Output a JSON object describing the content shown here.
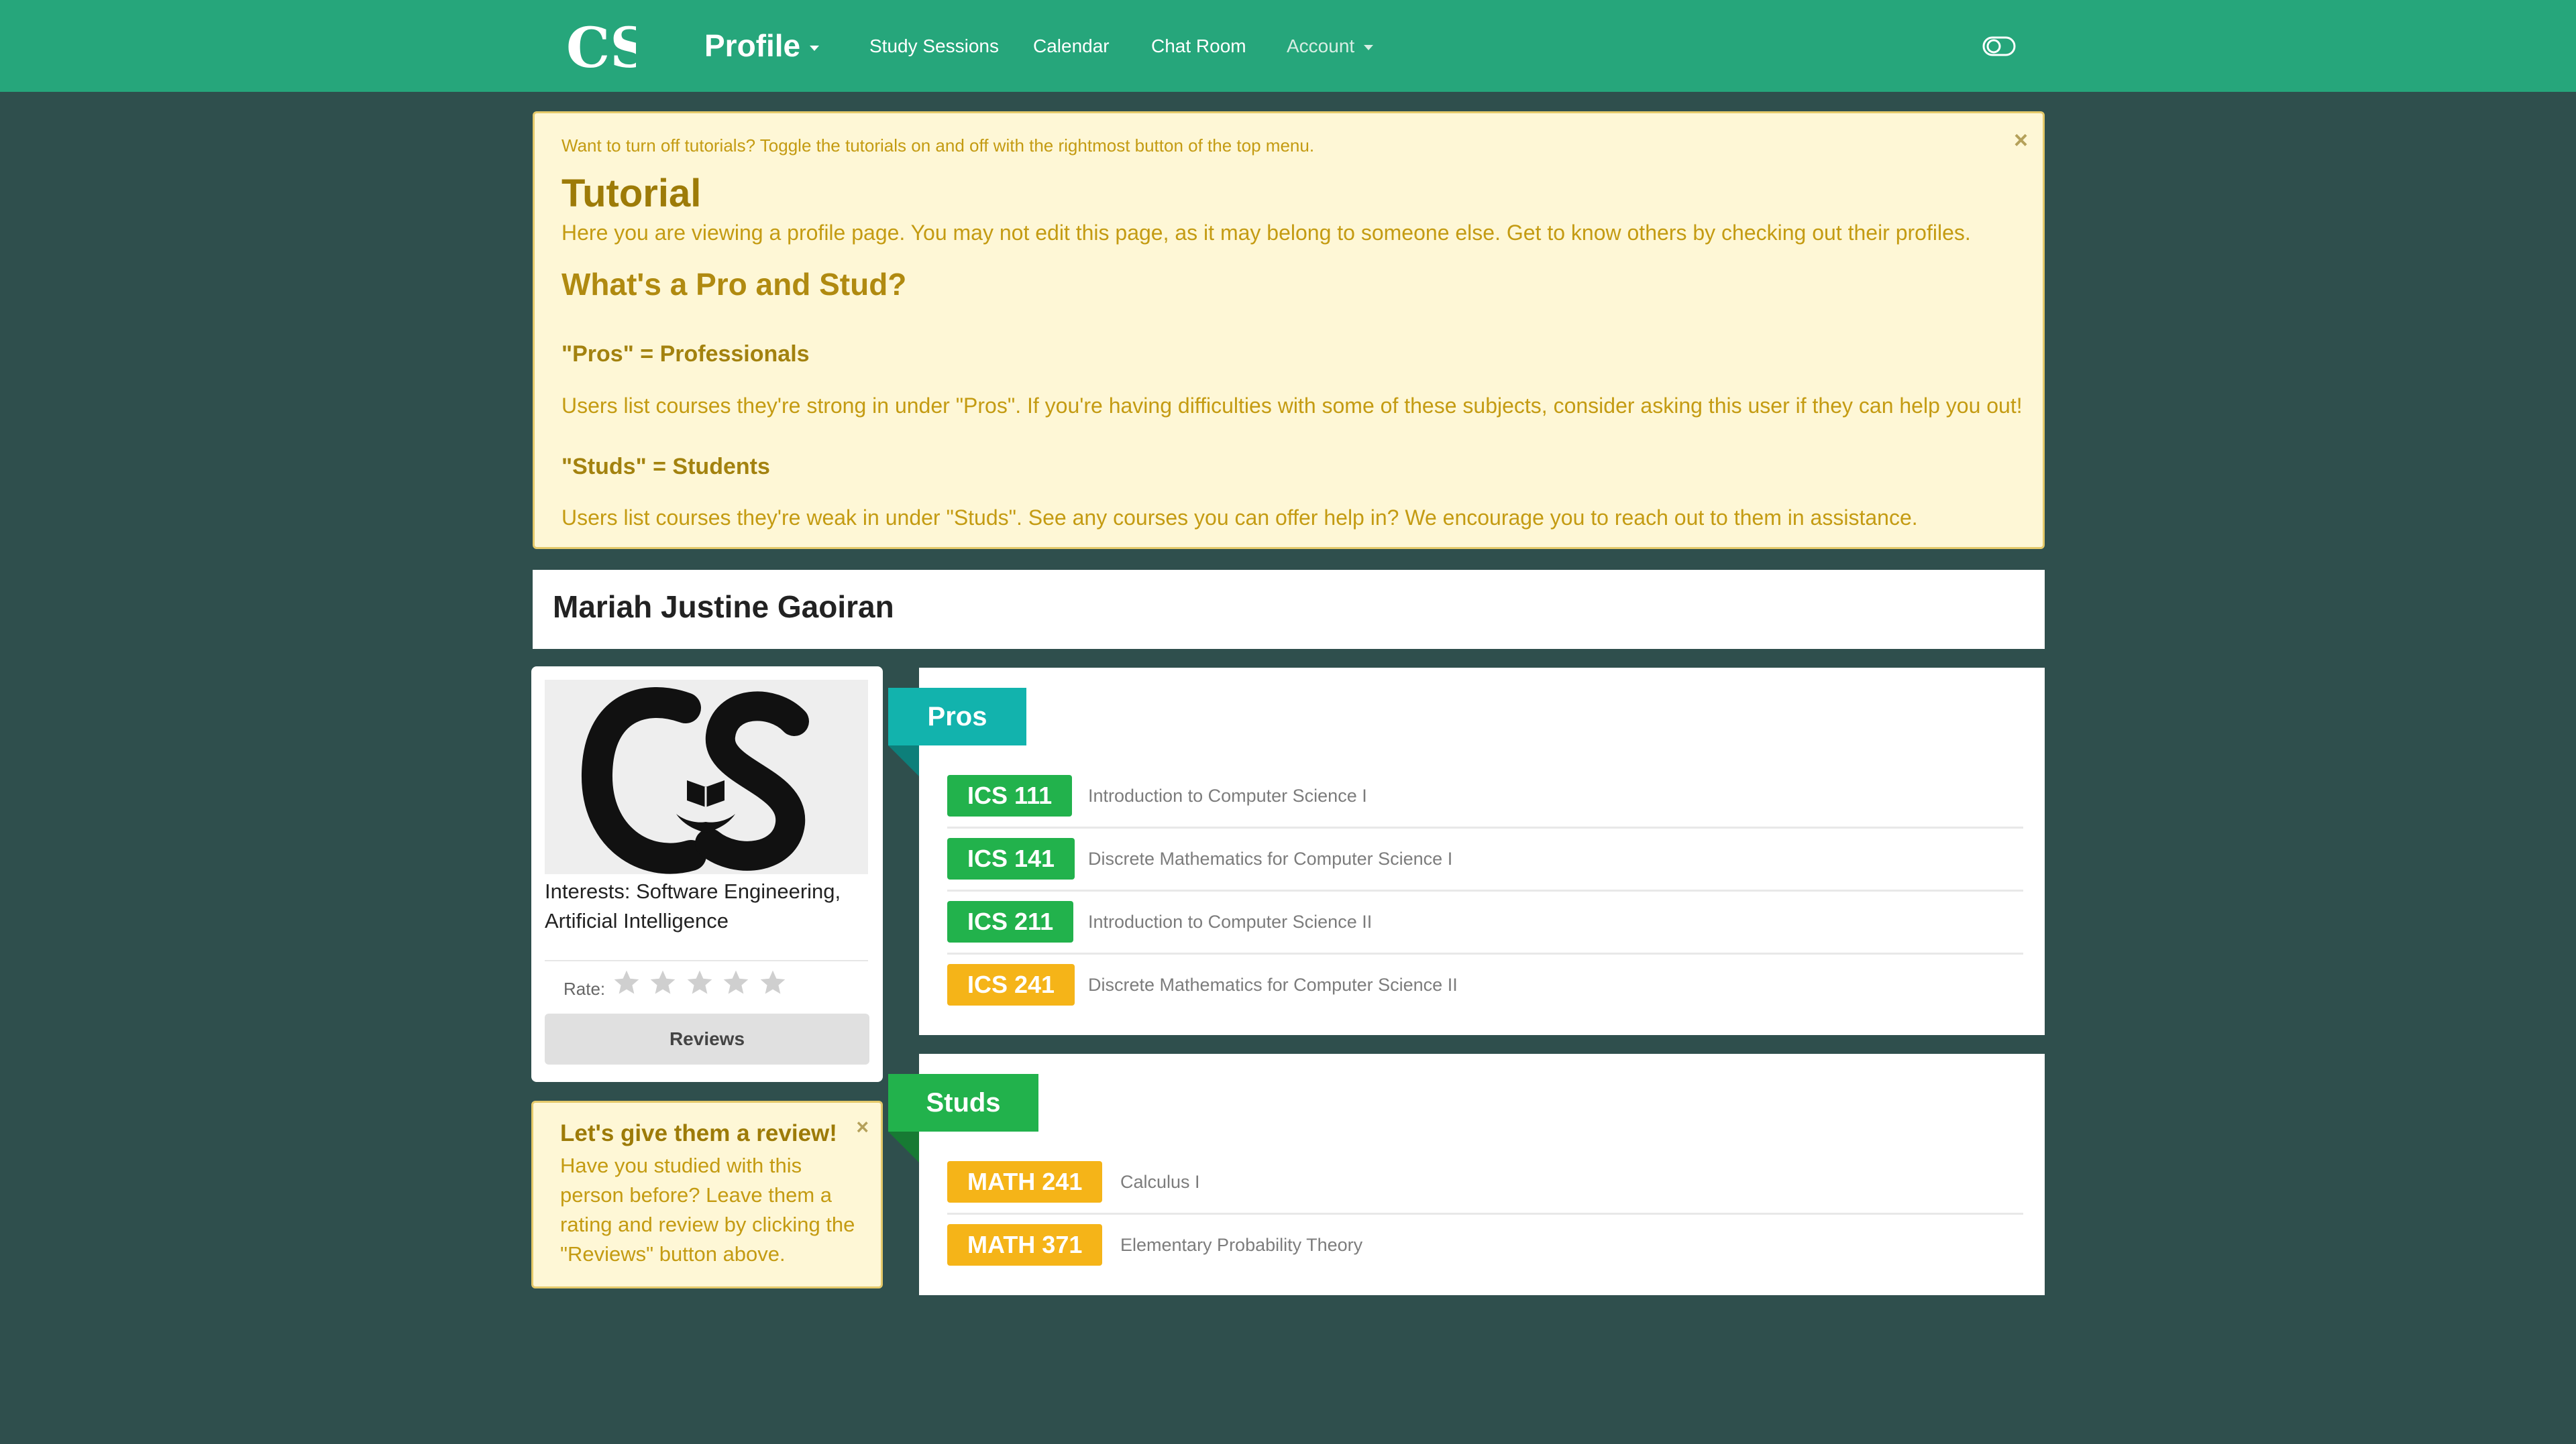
{
  "nav": {
    "brand": "Profile",
    "links": [
      "Study Sessions",
      "Calendar",
      "Chat Room"
    ],
    "account": "Account",
    "toggle_icon": "toggle-icon",
    "logo_text": "CS"
  },
  "tutorial": {
    "intro": "Want to turn off tutorials? Toggle the tutorials on and off with the rightmost button of the top menu.",
    "title": "Tutorial",
    "description": "Here you are viewing a profile page. You may not edit this page, as it may belong to someone else. Get to know others by checking out their profiles.",
    "subtitle": "What's a Pro and Stud?",
    "pros_heading": "\"Pros\" = Professionals",
    "pros_text": "Users list courses they're strong in under \"Pros\". If you're having difficulties with some of these subjects, consider asking this user if they can help you out!",
    "studs_heading": "\"Studs\" = Students",
    "studs_text": "Users list courses they're weak in under \"Studs\". See any courses you can offer help in? We encourage you to reach out to them in assistance.",
    "close": "×"
  },
  "profile": {
    "name": "Mariah Justine Gaoiran",
    "interests": "Interests: Software Engineering, Artificial Intelligence",
    "rate_label": "Rate:",
    "rating": 0,
    "rating_max": 5,
    "reviews_button": "Reviews"
  },
  "review_prompt": {
    "title": "Let's give them a review!",
    "body": "Have you studied with this person before? Leave them a rating and review by clicking the \"Reviews\" button above.",
    "close": "×"
  },
  "pros": {
    "label": "Pros",
    "courses": [
      {
        "code": "ICS 111",
        "name": "Introduction to Computer Science I",
        "color": "#22b24c"
      },
      {
        "code": "ICS 141",
        "name": "Discrete Mathematics for Computer Science I",
        "color": "#22b24c"
      },
      {
        "code": "ICS 211",
        "name": "Introduction to Computer Science II",
        "color": "#22b24c"
      },
      {
        "code": "ICS 241",
        "name": "Discrete Mathematics for Computer Science II",
        "color": "#f5b418"
      }
    ]
  },
  "studs": {
    "label": "Studs",
    "courses": [
      {
        "code": "MATH 241",
        "name": "Calculus I",
        "color": "#f5b418"
      },
      {
        "code": "MATH 371",
        "name": "Elementary Probability Theory",
        "color": "#f5b418"
      }
    ]
  },
  "colors": {
    "navbar": "#26a67b",
    "background": "#2f4f4d",
    "pros_ribbon": "#12b3ad",
    "studs_ribbon": "#22b24c",
    "alert_bg": "#fef7d6",
    "alert_text": "#c49b12"
  }
}
